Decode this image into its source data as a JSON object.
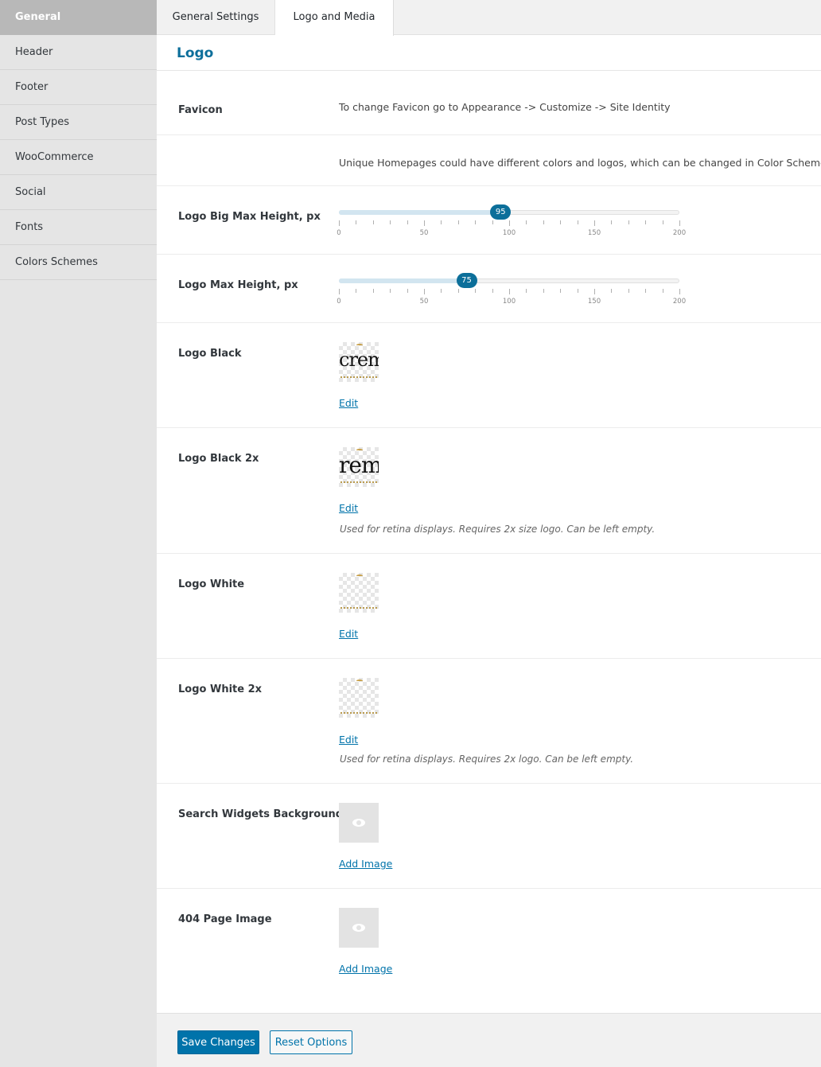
{
  "sidebar": {
    "items": [
      {
        "label": "General",
        "active": true
      },
      {
        "label": "Header"
      },
      {
        "label": "Footer"
      },
      {
        "label": "Post Types"
      },
      {
        "label": "WooCommerce"
      },
      {
        "label": "Social"
      },
      {
        "label": "Fonts"
      },
      {
        "label": "Colors Schemes"
      }
    ]
  },
  "tabs": [
    {
      "label": "General Settings"
    },
    {
      "label": "Logo and Media",
      "active": true
    }
  ],
  "section": {
    "title": "Logo"
  },
  "rows": {
    "favicon": {
      "label": "Favicon",
      "desc": "To change Favicon go to Appearance -> Customize -> Site Identity"
    },
    "unique": {
      "desc": "Unique Homepages could have different colors and logos, which can be changed in Color Schemes."
    },
    "logo_big_max_height": {
      "label": "Logo Big Max Height, px",
      "value": 95,
      "min": 0,
      "max": 200,
      "tick_labels": [
        "0",
        "50",
        "100",
        "150",
        "200"
      ]
    },
    "logo_max_height": {
      "label": "Logo Max Height, px",
      "value": 75,
      "min": 0,
      "max": 200,
      "tick_labels": [
        "0",
        "50",
        "100",
        "150",
        "200"
      ]
    },
    "logo_black": {
      "label": "Logo Black",
      "thumb_text": "crems",
      "link": "Edit"
    },
    "logo_black_2x": {
      "label": "Logo Black 2x",
      "thumb_text": "rem",
      "link": "Edit",
      "note": "Used for retina displays. Requires 2x size logo. Can be left empty."
    },
    "logo_white": {
      "label": "Logo White",
      "link": "Edit"
    },
    "logo_white_2x": {
      "label": "Logo White 2x",
      "link": "Edit",
      "note": "Used for retina displays. Requires 2x logo. Can be left empty."
    },
    "search_widgets_bg": {
      "label": "Search Widgets Background",
      "link": "Add Image"
    },
    "page_404_image": {
      "label": "404 Page Image",
      "link": "Add Image"
    }
  },
  "buttons": {
    "save": "Save Changes",
    "reset": "Reset Options"
  },
  "colors": {
    "accent": "#0073aa",
    "slider_handle": "#0c6f9a",
    "title": "#0d6f9b"
  }
}
